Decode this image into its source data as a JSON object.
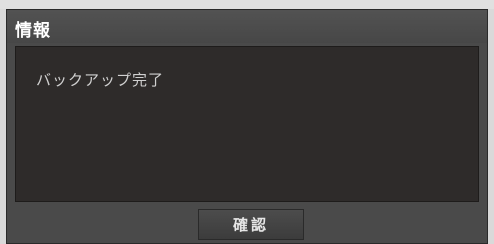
{
  "dialog": {
    "title": "情報",
    "message": "バックアップ完了",
    "confirm_label": "確認"
  }
}
